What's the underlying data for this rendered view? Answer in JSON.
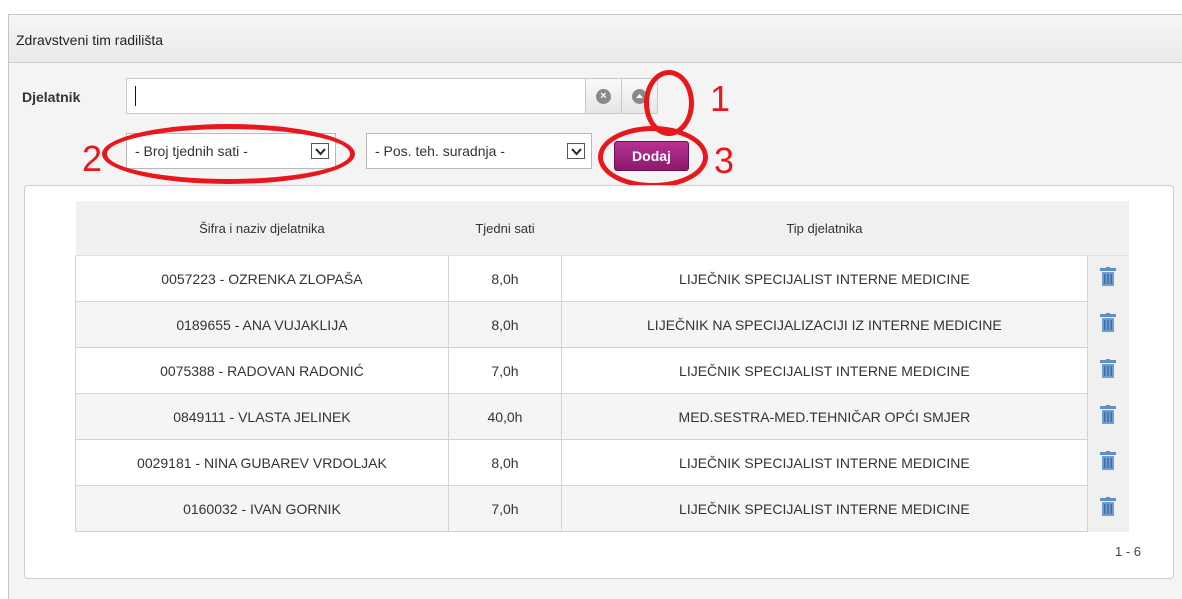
{
  "panel": {
    "title": "Zdravstveni tim radilišta"
  },
  "form": {
    "employee_label": "Djelatnik",
    "employee_value": "",
    "hours_select": "- Broj tjednih sati -",
    "cooperation_select": "- Pos. teh. suradnja -",
    "add_label": "Dodaj"
  },
  "annotations": [
    "1",
    "2",
    "3"
  ],
  "annotation_color": "#e8171d",
  "accent_color": "#9c2279",
  "table": {
    "headers": [
      "Šifra i naziv djelatnika",
      "Tjedni sati",
      "Tip djelatnika"
    ],
    "rows": [
      {
        "employee": "0057223 - OZRENKA ZLOPAŠA",
        "hours": "8,0h",
        "type": "LIJEČNIK SPECIJALIST INTERNE MEDICINE"
      },
      {
        "employee": "0189655 - ANA VUJAKLIJA",
        "hours": "8,0h",
        "type": "LIJEČNIK NA SPECIJALIZACIJI IZ INTERNE MEDICINE"
      },
      {
        "employee": "0075388 - RADOVAN RADONIĆ",
        "hours": "7,0h",
        "type": "LIJEČNIK SPECIJALIST INTERNE MEDICINE"
      },
      {
        "employee": "0849111 - VLASTA JELINEK",
        "hours": "40,0h",
        "type": "MED.SESTRA-MED.TEHNIČAR OPĆI SMJER"
      },
      {
        "employee": "0029181 - NINA GUBAREV VRDOLJAK",
        "hours": "8,0h",
        "type": "LIJEČNIK SPECIJALIST INTERNE MEDICINE"
      },
      {
        "employee": "0160032 - IVAN GORNIK",
        "hours": "7,0h",
        "type": "LIJEČNIK SPECIJALIST INTERNE MEDICINE"
      }
    ]
  },
  "pager": "1 - 6",
  "icons": {
    "clear": "clear-icon",
    "toggle": "chevron-up-icon",
    "delete": "trash-icon",
    "dropdown": "chevron-down-icon"
  }
}
